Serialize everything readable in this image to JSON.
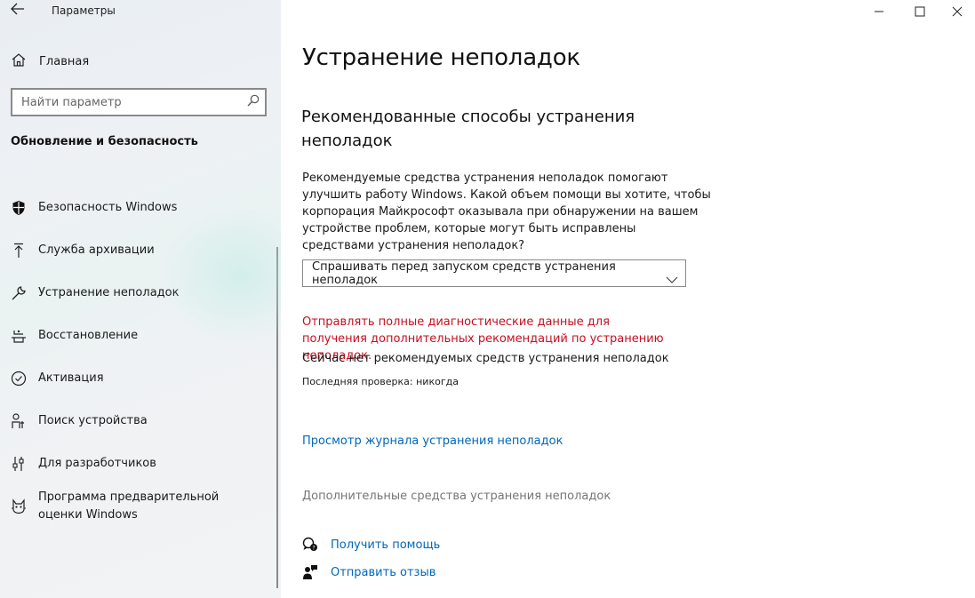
{
  "window": {
    "title": "Параметры",
    "back_icon": "back-arrow-icon",
    "minimize_icon": "minimize-icon",
    "maximize_icon": "maximize-icon",
    "close_icon": "close-icon"
  },
  "sidebar": {
    "home": {
      "label": "Главная",
      "icon": "home-icon"
    },
    "search": {
      "placeholder": "Найти параметр",
      "value": "",
      "icon": "search-icon"
    },
    "section_title": "Обновление и безопасность",
    "items": [
      {
        "label": "Безопасность Windows",
        "icon": "shield-icon"
      },
      {
        "label": "Служба архивации",
        "icon": "backup-arrow-icon"
      },
      {
        "label": "Устранение неполадок",
        "icon": "wrench-icon"
      },
      {
        "label": "Восстановление",
        "icon": "recovery-icon"
      },
      {
        "label": "Активация",
        "icon": "check-circle-icon"
      },
      {
        "label": "Поиск устройства",
        "icon": "person-pin-icon"
      },
      {
        "label": "Для разработчиков",
        "icon": "developer-sliders-icon"
      },
      {
        "label": "Программа предварительной оценки Windows",
        "icon": "insider-cat-icon"
      }
    ]
  },
  "main": {
    "title": "Устранение неполадок",
    "subtitle": "Рекомендованные способы устранения неполадок",
    "description": "Рекомендуемые средства устранения неполадок помогают улучшить работу Windows. Какой объем помощи вы хотите, чтобы корпорация Майкрософт оказывала при обнаружении на вашем устройстве проблем, которые могут быть исправлены средствами устранения неполадок?",
    "dropdown": {
      "selected": "Спрашивать перед запуском средств устранения неполадок",
      "icon": "chevron-down-icon"
    },
    "warning": "Отправлять полные диагностические данные для получения дополнительных рекомендаций по устранению неполадок.",
    "status": "Сейчас нет рекомендуемых средств устранения неполадок",
    "last_check": "Последняя проверка: никогда",
    "history_link": "Просмотр журнала устранения неполадок",
    "additional": "Дополнительные средства устранения неполадок",
    "help": {
      "label": "Получить помощь",
      "icon": "chat-help-icon"
    },
    "feedback": {
      "label": "Отправить отзыв",
      "icon": "feedback-person-icon"
    }
  },
  "colors": {
    "accent": "#0067b8",
    "warning": "#c50f1f",
    "disabled": "#767676"
  }
}
